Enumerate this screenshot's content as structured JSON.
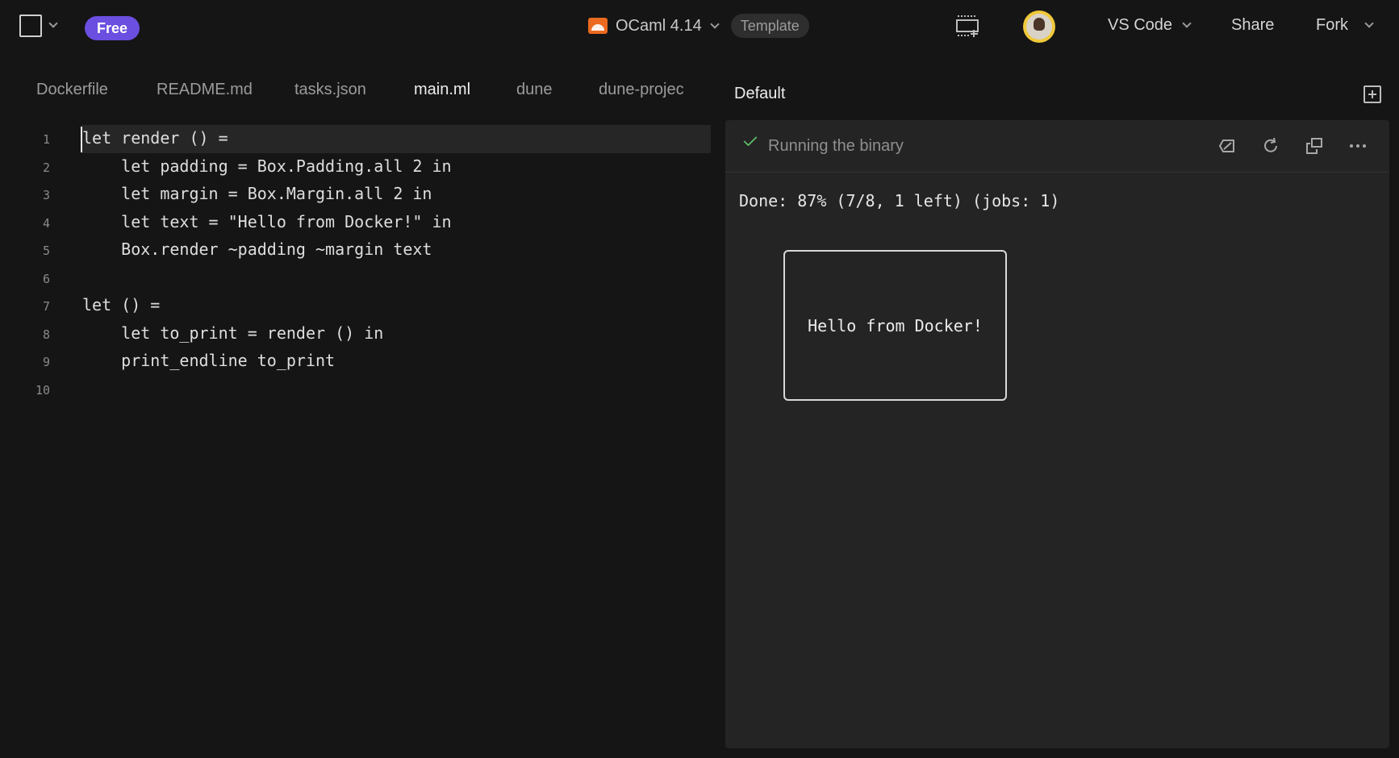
{
  "topbar": {
    "plan_badge": "Free",
    "language": "OCaml 4.14",
    "template_badge": "Template",
    "editor_button": "VS Code",
    "share_button": "Share",
    "fork_button": "Fork",
    "icons": [
      "square-icon",
      "chevron-down-icon",
      "ocaml-logo-icon",
      "preview-window-icon",
      "user-avatar"
    ]
  },
  "tabs": [
    {
      "label": "Dockerfile",
      "active": false
    },
    {
      "label": "README.md",
      "active": false
    },
    {
      "label": "tasks.json",
      "active": false
    },
    {
      "label": "main.ml",
      "active": true
    },
    {
      "label": "dune",
      "active": false
    },
    {
      "label": "dune-projec",
      "active": false
    }
  ],
  "editor": {
    "current_line": 1,
    "lines": [
      {
        "num": "1",
        "text": "let render () ="
      },
      {
        "num": "2",
        "text": "    let padding = Box.Padding.all 2 in"
      },
      {
        "num": "3",
        "text": "    let margin = Box.Margin.all 2 in"
      },
      {
        "num": "4",
        "text": "    let text = \"Hello from Docker!\" in"
      },
      {
        "num": "5",
        "text": "    Box.render ~padding ~margin text"
      },
      {
        "num": "6",
        "text": ""
      },
      {
        "num": "7",
        "text": "let () ="
      },
      {
        "num": "8",
        "text": "    let to_print = render () in"
      },
      {
        "num": "9",
        "text": "    print_endline to_print"
      },
      {
        "num": "10",
        "text": ""
      }
    ]
  },
  "output_pane": {
    "tab_label": "Default",
    "status": "Running the binary",
    "build_progress": "Done: 87% (7/8, 1 left) (jobs: 1)",
    "box_text": "Hello from Docker!",
    "status_color": "#5fbf6a",
    "icons": [
      "clear-icon",
      "refresh-icon",
      "open-external-icon",
      "more-icon"
    ]
  },
  "colors": {
    "background": "#151515",
    "pane_background": "#242424",
    "accent": "#6a4fe0",
    "ocaml_orange": "#ec6a1f"
  }
}
